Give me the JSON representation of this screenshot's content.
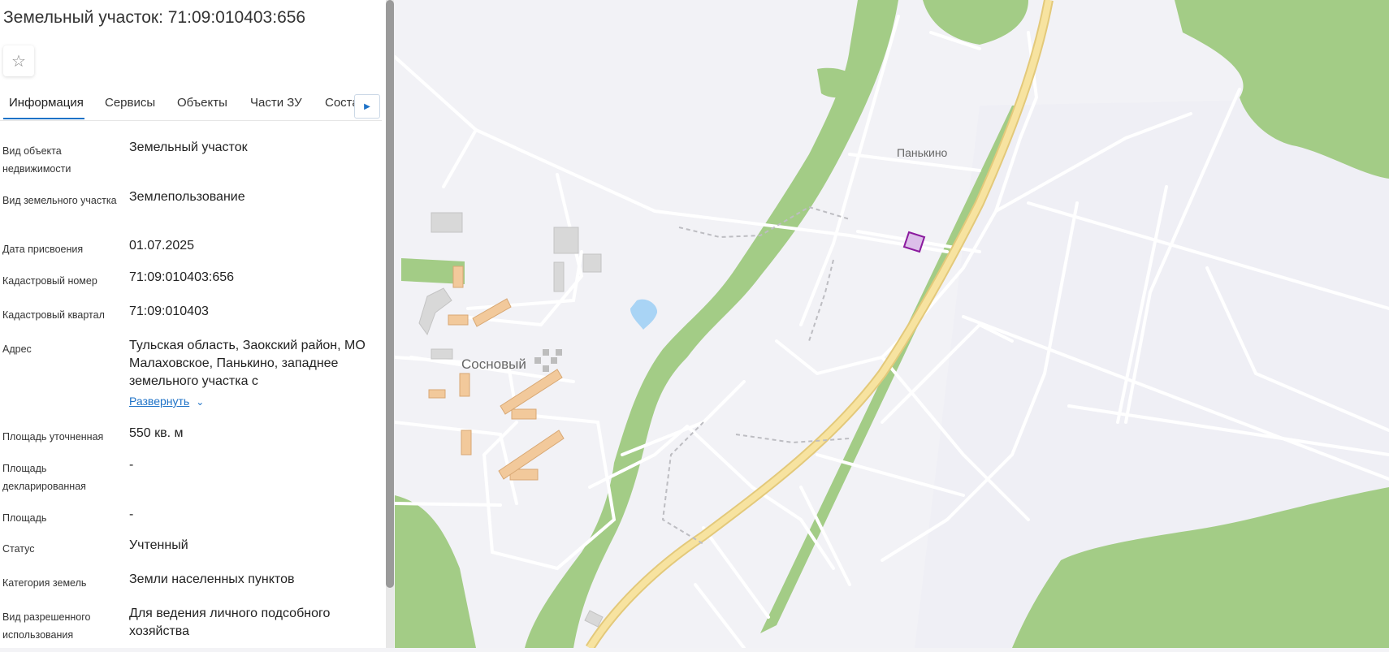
{
  "header": {
    "title": "Земельный участок: 71:09:010403:656"
  },
  "favorite": {
    "icon": "star-icon"
  },
  "tabs": [
    {
      "label": "Информация",
      "active": true
    },
    {
      "label": "Сервисы"
    },
    {
      "label": "Объекты"
    },
    {
      "label": "Части ЗУ"
    },
    {
      "label": "Соста"
    }
  ],
  "tabs_next_icon": "chevron-right-icon",
  "fields": {
    "object_type": {
      "label": "Вид объекта недвижимости",
      "value": "Земельный участок"
    },
    "land_type": {
      "label": "Вид земельного участка",
      "value": "Землепользование"
    },
    "assign_date": {
      "label": "Дата присвоения",
      "value": "01.07.2025"
    },
    "cadastral_number": {
      "label": "Кадастровый номер",
      "value": "71:09:010403:656"
    },
    "cadastral_quarter": {
      "label": "Кадастровый квартал",
      "value": "71:09:010403"
    },
    "address": {
      "label": "Адрес",
      "value": "Тульская область, Заокский район, МО Малаховское, Панькино, западнее земельного участка с",
      "expand": "Развернуть"
    },
    "area_refined": {
      "label": "Площадь уточненная",
      "value": "550 кв. м"
    },
    "area_declared": {
      "label": "Площадь декларированная",
      "value": "-"
    },
    "area": {
      "label": "Площадь",
      "value": "-"
    },
    "status": {
      "label": "Статус",
      "value": "Учтенный"
    },
    "land_category": {
      "label": "Категория земель",
      "value": "Земли населенных пунктов"
    },
    "permitted_use": {
      "label": "Вид разрешенного использования",
      "value": "Для ведения личного подсобного хозяйства"
    }
  },
  "map": {
    "labels": {
      "sosnovy": "Сосновый",
      "pankino": "Панькино"
    },
    "colors": {
      "forest": "#a3cc86",
      "road": "#ffffff",
      "highway": "#f5dc8c",
      "building": "#f2c99b",
      "parcel": "#dcbfe9",
      "parcel_border": "#8b1a9e",
      "water": "#a9d4f5"
    }
  }
}
